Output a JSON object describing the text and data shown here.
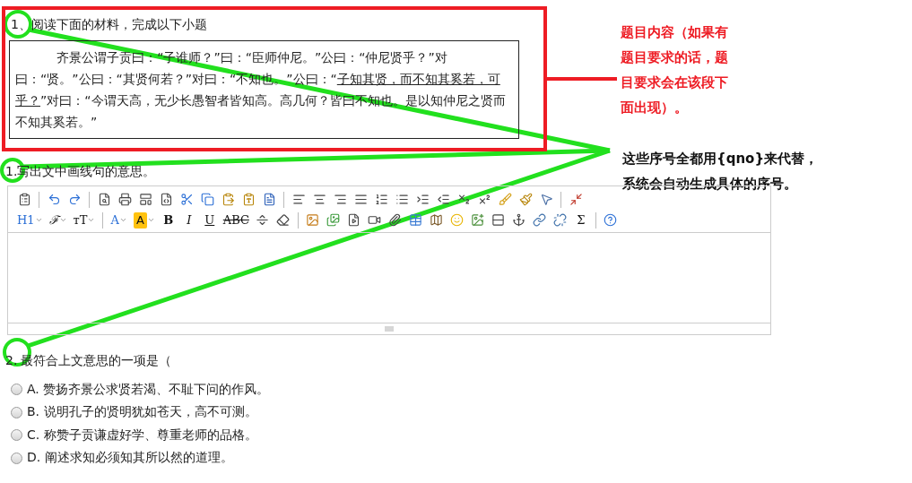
{
  "question": {
    "number": "1、",
    "title": "阅读下面的材料，完成以下小题",
    "passage": [
      {
        "text": "齐景公谓子贡曰：“子谁师？”曰：“臣师仲尼。”公曰：“仲尼贤乎？”对曰：“贤。”公曰：“其贤何若？”对曰：“不知也。”公曰：“",
        "underlined": false
      },
      {
        "text": "子知其贤，而不知其奚若，可乎？",
        "underlined": true
      },
      {
        "text": "”对曰：“今谓天高，无少长愚智者皆知高。高几何？皆曰不知也。是以知仲尼之贤而不知其奚若。”",
        "underlined": false
      }
    ]
  },
  "annotations": {
    "content_note": "题目内容（如果有题目要求的话，题目要求会在该段下面出现）。",
    "numbering_note": "这些序号全都用{qno}来代替，系统会自动生成具体的序号。"
  },
  "sub_question_1": {
    "number": "1.",
    "text": "写出文中画线句的意思。"
  },
  "editor": {
    "toolbar": [
      [
        {
          "kind": "source"
        },
        {
          "kind": "separator"
        },
        {
          "kind": "undo"
        },
        {
          "kind": "redo"
        },
        {
          "kind": "separator"
        },
        {
          "kind": "preview"
        },
        {
          "kind": "print"
        },
        {
          "kind": "template"
        },
        {
          "kind": "code"
        },
        {
          "kind": "cut"
        },
        {
          "kind": "copy"
        },
        {
          "kind": "paste"
        },
        {
          "kind": "paste-text"
        },
        {
          "kind": "paste-word"
        },
        {
          "kind": "separator"
        },
        {
          "kind": "align-left"
        },
        {
          "kind": "align-center"
        },
        {
          "kind": "align-right"
        },
        {
          "kind": "align-justify"
        },
        {
          "kind": "ordered-list"
        },
        {
          "kind": "bullet-list"
        },
        {
          "kind": "indent"
        },
        {
          "kind": "outdent"
        },
        {
          "kind": "subscript"
        },
        {
          "kind": "superscript"
        },
        {
          "kind": "clear-format"
        },
        {
          "kind": "format-painter"
        },
        {
          "kind": "select-all"
        },
        {
          "kind": "separator"
        },
        {
          "kind": "fullscreen"
        }
      ],
      [
        {
          "kind": "heading",
          "label": "H1"
        },
        {
          "kind": "font-family",
          "label": "ℱ"
        },
        {
          "kind": "font-size",
          "label": "ᴛT"
        },
        {
          "kind": "separator"
        },
        {
          "kind": "font-color",
          "label": "A"
        },
        {
          "kind": "highlight",
          "label": "A"
        },
        {
          "kind": "bold",
          "label": "B"
        },
        {
          "kind": "italic",
          "label": "I"
        },
        {
          "kind": "underline",
          "label": "U"
        },
        {
          "kind": "strikethrough",
          "label": "ABC"
        },
        {
          "kind": "horizontal-rule"
        },
        {
          "kind": "eraser"
        },
        {
          "kind": "separator"
        },
        {
          "kind": "image"
        },
        {
          "kind": "multi-image"
        },
        {
          "kind": "flash"
        },
        {
          "kind": "video"
        },
        {
          "kind": "attachment"
        },
        {
          "kind": "table"
        },
        {
          "kind": "map"
        },
        {
          "kind": "emoji"
        },
        {
          "kind": "picture"
        },
        {
          "kind": "page-break"
        },
        {
          "kind": "anchor"
        },
        {
          "kind": "link"
        },
        {
          "kind": "unlink"
        },
        {
          "kind": "formula",
          "label": "Σ"
        },
        {
          "kind": "separator"
        },
        {
          "kind": "help"
        }
      ]
    ]
  },
  "sub_question_2": {
    "number": "2.",
    "text": "最符合上文意思的一项是（",
    "options": [
      {
        "letter": "A.",
        "text": "赞扬齐景公求贤若渴、不耻下问的作风。",
        "selected": false
      },
      {
        "letter": "B.",
        "text": "说明孔子的贤明犹如苍天，高不可测。",
        "selected": false
      },
      {
        "letter": "C.",
        "text": "称赞子贡谦虚好学、尊重老师的品格。",
        "selected": false
      },
      {
        "letter": "D.",
        "text": "阐述求知必须知其所以然的道理。",
        "selected": false
      }
    ]
  }
}
